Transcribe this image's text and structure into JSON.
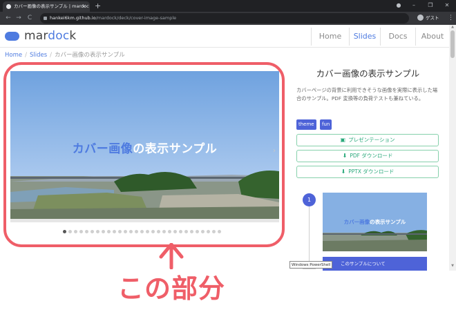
{
  "browser": {
    "tab_title": "カバー画像の表示サンプル | mardoc",
    "tab_close": "✕",
    "new_tab": "+",
    "url_host": "hankei6km.github.io",
    "url_path": "/mardock/deck/cover-image-sample",
    "profile_label": "ゲスト",
    "window_minimize": "–",
    "window_restore": "❐",
    "window_close": "✕",
    "back": "←",
    "forward": "→",
    "reload": "C",
    "menu": "⋮",
    "account_icon": "●"
  },
  "site": {
    "logo_pre": "mar",
    "logo_accent": "doc",
    "logo_post": "k",
    "nav": {
      "home": "Home",
      "slides": "Slides",
      "docs": "Docs",
      "about": "About"
    }
  },
  "breadcrumb": {
    "home": "Home",
    "slides": "Slides",
    "current": "カバー画像の表示サンプル"
  },
  "slide": {
    "title_highlight": "カバー画像",
    "title_rest": "の表示サンプル",
    "next_arrow": "›",
    "dot_count": 29,
    "active_dot": 1
  },
  "sidebar": {
    "title": "カバー画像の表示サンプル",
    "description": "カバーページの背景に利用できそうな画像を実際に表示した場合のサンプル。PDF 変換等の負荷テストも兼ねている。",
    "tags": [
      "theme",
      "fun"
    ],
    "buttons": {
      "presentation": "プレゼンテーション",
      "pdf": "PDF ダウンロード",
      "pptx": "PPTX ダウンロード"
    },
    "icons": {
      "presentation": "▣",
      "download": "⬇"
    },
    "timeline_number": "1",
    "thumb_title_highlight": "カバー画像",
    "thumb_title_rest": "の表示サンプル",
    "next_card": "このサンプルについて",
    "tooltip": "Windows PowerShell"
  },
  "annotation": {
    "callout": "この部分",
    "color": "#ef5e68"
  },
  "colors": {
    "accent": "#4e7be0",
    "tag": "#4e63d8",
    "button_green": "#28a87a"
  }
}
